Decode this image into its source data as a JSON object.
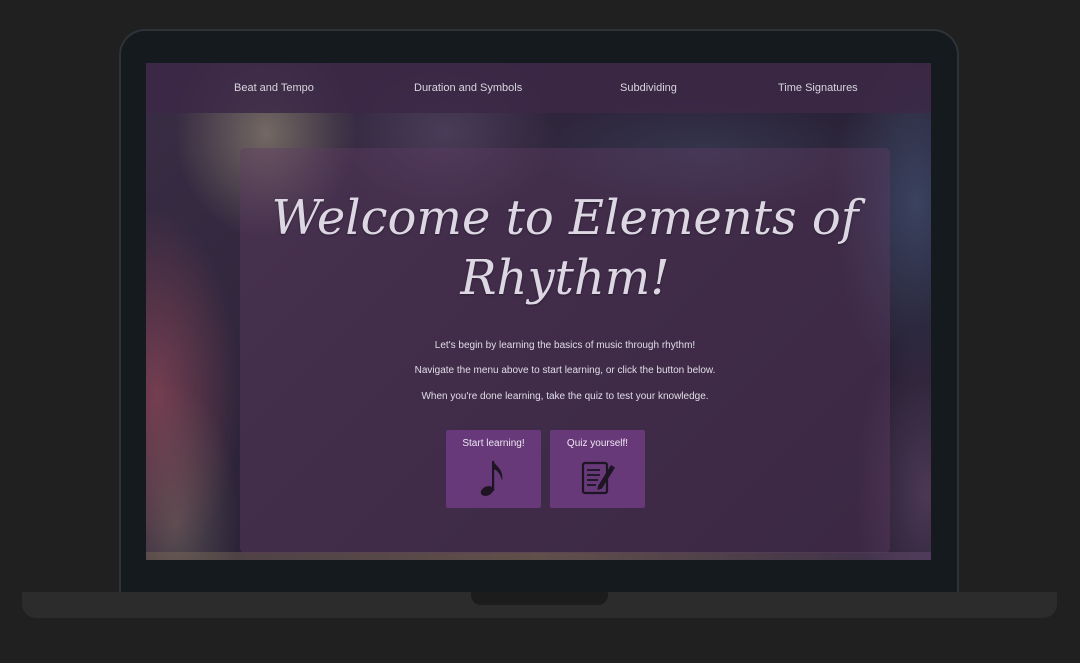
{
  "nav": {
    "items": [
      {
        "label": "Beat and Tempo"
      },
      {
        "label": "Duration and Symbols"
      },
      {
        "label": "Subdividing"
      },
      {
        "label": "Time Signatures"
      }
    ]
  },
  "hero": {
    "title_line1": "Welcome to Elements of",
    "title_line2": "Rhythm!",
    "lines": [
      "Let's begin by learning the basics of music through rhythm!",
      "Navigate the menu above to start learning, or click the button below.",
      "When you're done learning, take the quiz to test your knowledge."
    ]
  },
  "buttons": {
    "start": {
      "label": "Start learning!",
      "icon": "music-note-icon"
    },
    "quiz": {
      "label": "Quiz yourself!",
      "icon": "notepad-pencil-icon"
    }
  },
  "colors": {
    "page_background": "#202020",
    "bezel": "#151a1f",
    "button": "#6e3c82",
    "text": "#e0dce6"
  }
}
